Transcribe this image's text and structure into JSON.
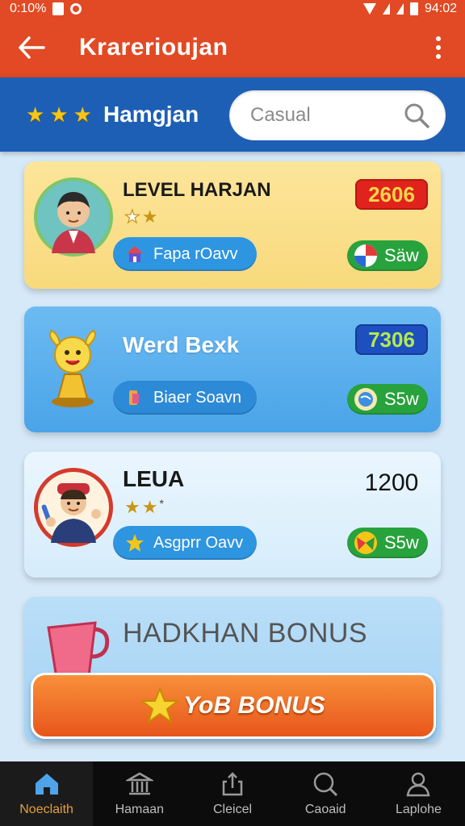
{
  "status_bar": {
    "left_text": "0:10%",
    "time": "94:02"
  },
  "app_bar": {
    "title": "Krarerioujan"
  },
  "header": {
    "title": "Hamgjan",
    "stars": 3,
    "search_placeholder": "Casual"
  },
  "cards": [
    {
      "title": "LEVEL HARJAN",
      "score": "2606",
      "stars_filled": 1,
      "stars_outline": 1,
      "pill_label": "Fapa rOavv",
      "go_label": "Säw",
      "score_color": "#e0231c"
    },
    {
      "title": "Werd Bexk",
      "score": "7306",
      "pill_label": "Biaer Soavn",
      "go_label": "S5w",
      "score_color": "#1d4fc0"
    },
    {
      "title": "LEUA",
      "score": "1200",
      "stars_filled": 2,
      "pill_label": "Asgprr Oavv",
      "go_label": "S5w"
    }
  ],
  "bonus": {
    "title": "HADKHAN BONUS",
    "button_label": "YoB BONUS"
  },
  "bottom_nav": [
    {
      "label": "Noeclaith",
      "icon": "home-icon",
      "active": true
    },
    {
      "label": "Hamaan",
      "icon": "bank-icon",
      "active": false
    },
    {
      "label": "Cleicel",
      "icon": "share-icon",
      "active": false
    },
    {
      "label": "Caoaid",
      "icon": "search-icon",
      "active": false
    },
    {
      "label": "Laplohe",
      "icon": "profile-icon",
      "active": false
    }
  ],
  "colors": {
    "app_bar": "#e14a24",
    "header": "#1d5fb5",
    "background": "#d6e9f8",
    "accent_green": "#28a23c"
  }
}
